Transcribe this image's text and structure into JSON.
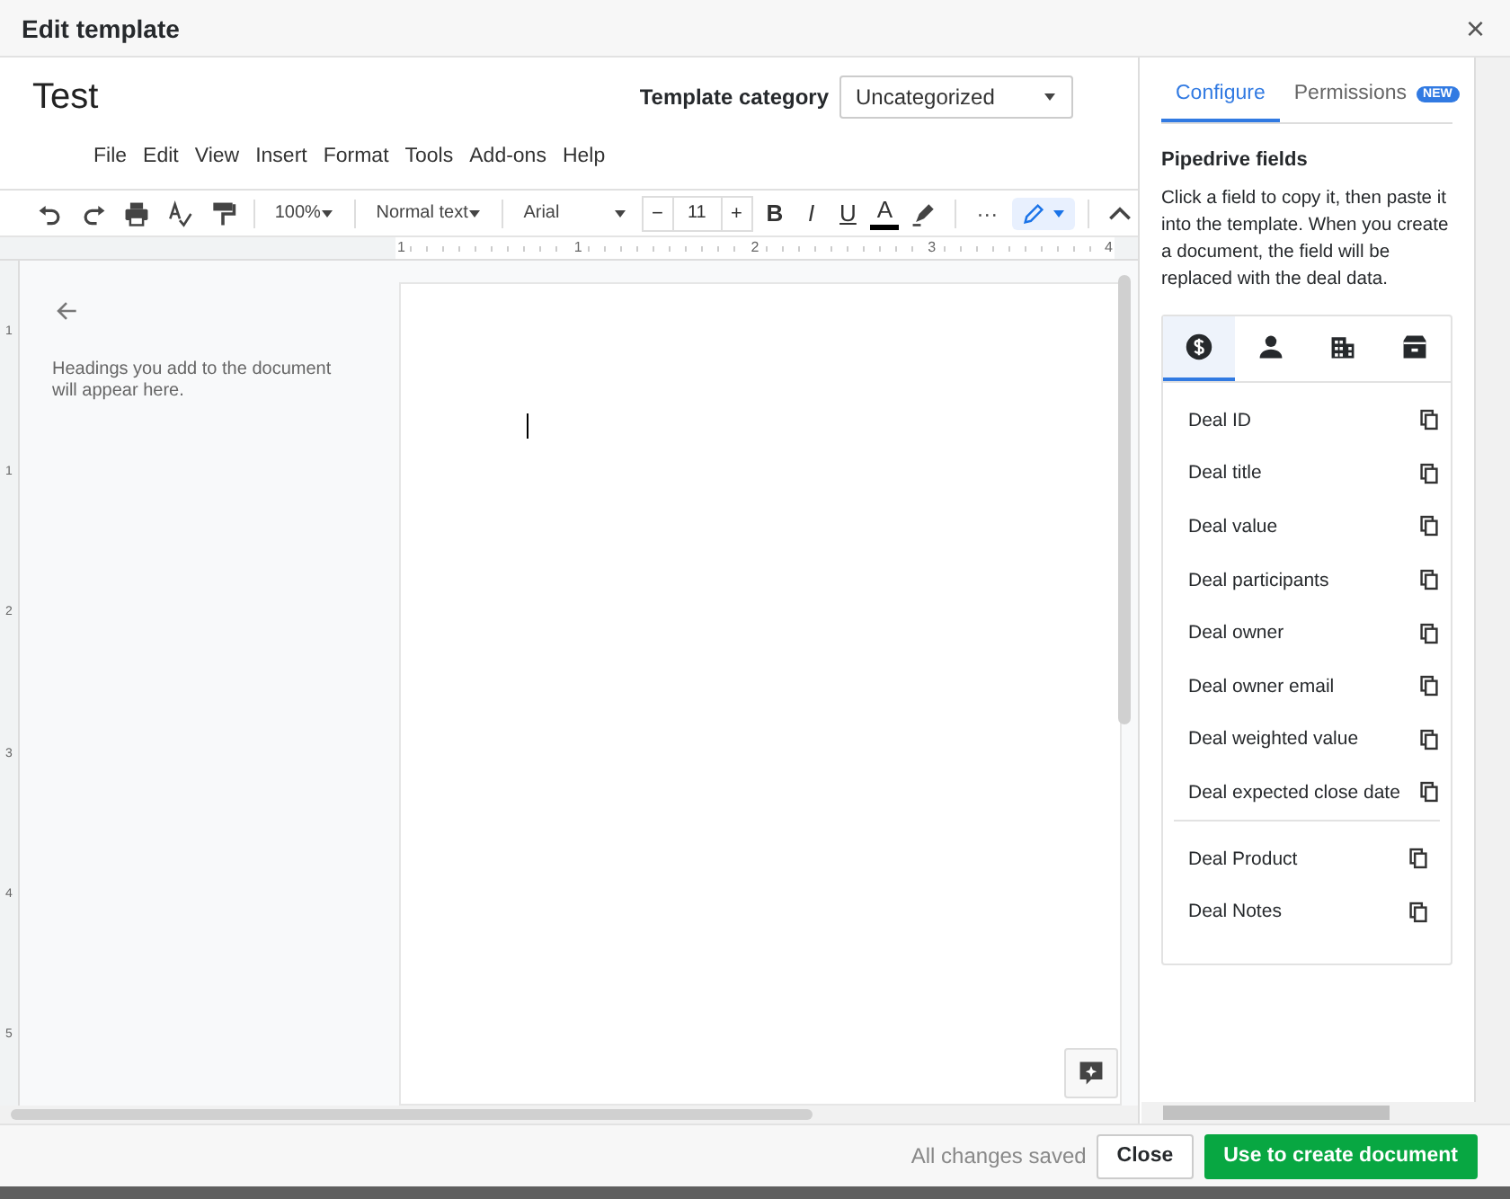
{
  "window": {
    "title": "Edit template",
    "close": "×"
  },
  "document": {
    "title": "Test",
    "category_label": "Template category",
    "category_value": "Uncategorized"
  },
  "menu": [
    "File",
    "Edit",
    "View",
    "Insert",
    "Format",
    "Tools",
    "Add-ons",
    "Help"
  ],
  "toolbar": {
    "zoom": "100%",
    "style": "Normal text",
    "font": "Arial",
    "font_size": "11",
    "minus": "−",
    "plus": "+",
    "format_buttons": [
      "B",
      "I",
      "U",
      "A"
    ],
    "more": "···",
    "edit_mode_selected": true
  },
  "ruler": {
    "top_labels": [
      "1",
      "1",
      "2",
      "3",
      "4"
    ],
    "side_labels": [
      "1",
      "1",
      "2",
      "3",
      "4",
      "5"
    ]
  },
  "outline": {
    "hint": "Headings you add to the document will appear here."
  },
  "panel": {
    "tabs": [
      {
        "label": "Configure",
        "selected": true
      },
      {
        "label": "Permissions",
        "selected": false,
        "badge": "NEW"
      }
    ],
    "heading": "Pipedrive fields",
    "description": "Click a field to copy it, then paste it into the template. When you create a document, the field will be replaced with the deal data.",
    "field_tabs": [
      {
        "kind": "deal",
        "selected": true
      },
      {
        "kind": "person",
        "selected": false
      },
      {
        "kind": "organization",
        "selected": false
      },
      {
        "kind": "product",
        "selected": false
      }
    ],
    "field_groups": [
      [
        "Deal ID",
        "Deal title",
        "Deal value",
        "Deal participants",
        "Deal owner",
        "Deal owner email",
        "Deal weighted value",
        "Deal expected close date"
      ],
      [
        "Deal Product",
        "Deal Notes"
      ]
    ]
  },
  "footer": {
    "status": "All changes saved",
    "buttons": [
      {
        "label": "Close",
        "kind": "secondary"
      },
      {
        "label": "Use to create document",
        "kind": "primary"
      }
    ]
  }
}
